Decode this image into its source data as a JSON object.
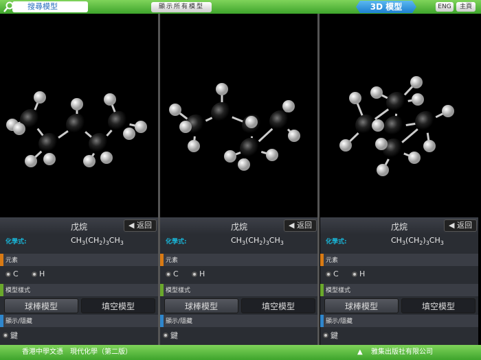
{
  "topbar": {
    "search_placeholder": "搜尋模型",
    "show_all": "顯示所有模型",
    "section_title": "3D 模型",
    "eng": "ENG",
    "home": "主頁"
  },
  "panels": [
    {
      "name": "戊烷",
      "back": "◀ 返回",
      "formula_label": "化學式:",
      "formula": [
        "CH",
        "3",
        "(CH",
        "2",
        ")",
        "3",
        "CH",
        "3"
      ],
      "elements_label": "元素",
      "elements": [
        "C",
        "H"
      ],
      "style_label": "模型樣式",
      "style_options": [
        "球棒模型",
        "填空模型"
      ],
      "selected_style": "球棒模型",
      "toggle_label": "顯示/隱藏",
      "toggle_items": [
        "鍵"
      ]
    },
    {
      "name": "戊烷",
      "back": "◀ 返回",
      "formula_label": "化學式:",
      "formula": [
        "CH",
        "3",
        "(CH",
        "2",
        ")",
        "3",
        "CH",
        "3"
      ],
      "elements_label": "元素",
      "elements": [
        "C",
        "H"
      ],
      "style_label": "模型樣式",
      "style_options": [
        "球棒模型",
        "填空模型"
      ],
      "selected_style": "球棒模型",
      "toggle_label": "顯示/隱藏",
      "toggle_items": [
        "鍵"
      ]
    },
    {
      "name": "戊烷",
      "back": "◀ 返回",
      "formula_label": "化學式:",
      "formula": [
        "CH",
        "3",
        "(CH",
        "2",
        ")",
        "3",
        "CH",
        "3"
      ],
      "elements_label": "元素",
      "elements": [
        "C",
        "H"
      ],
      "style_label": "模型樣式",
      "style_options": [
        "球棒模型",
        "填空模型"
      ],
      "selected_style": "球棒模型",
      "toggle_label": "顯示/隱藏",
      "toggle_items": [
        "鍵"
      ]
    }
  ],
  "footer": {
    "left": "香港中學文憑　現代化學（第二版）",
    "right": "雅集出版社有限公司"
  },
  "colors": {
    "green": "#3ea52c",
    "element_bar": "#d87a14",
    "style_bar": "#6aa82c",
    "toggle_bar": "#2f86cc",
    "formula_label": "#19b4d6"
  }
}
